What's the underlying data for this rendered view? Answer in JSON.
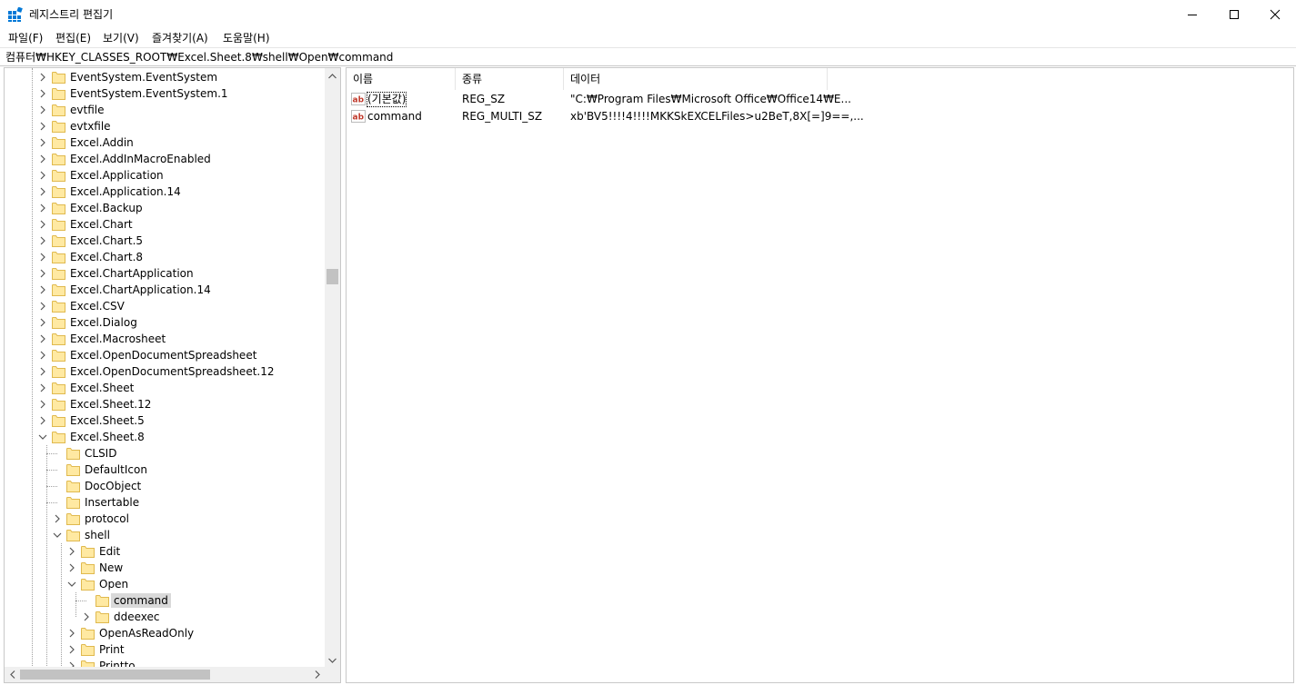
{
  "window": {
    "title": "레지스트리 편집기",
    "accent_color": "#0078d7"
  },
  "menu": [
    "파일(F)",
    "편집(E)",
    "보기(V)",
    "즐겨찾기(A)",
    "도움말(H)"
  ],
  "address": "컴퓨터₩HKEY_CLASSES_ROOT₩Excel.Sheet.8₩shell₩Open₩command",
  "tree": [
    {
      "label": "EventSystem.EventSystem",
      "level": 0,
      "state": "collapsed"
    },
    {
      "label": "EventSystem.EventSystem.1",
      "level": 0,
      "state": "collapsed"
    },
    {
      "label": "evtfile",
      "level": 0,
      "state": "collapsed"
    },
    {
      "label": "evtxfile",
      "level": 0,
      "state": "collapsed"
    },
    {
      "label": "Excel.Addin",
      "level": 0,
      "state": "collapsed"
    },
    {
      "label": "Excel.AddInMacroEnabled",
      "level": 0,
      "state": "collapsed"
    },
    {
      "label": "Excel.Application",
      "level": 0,
      "state": "collapsed"
    },
    {
      "label": "Excel.Application.14",
      "level": 0,
      "state": "collapsed"
    },
    {
      "label": "Excel.Backup",
      "level": 0,
      "state": "collapsed"
    },
    {
      "label": "Excel.Chart",
      "level": 0,
      "state": "collapsed"
    },
    {
      "label": "Excel.Chart.5",
      "level": 0,
      "state": "collapsed"
    },
    {
      "label": "Excel.Chart.8",
      "level": 0,
      "state": "collapsed"
    },
    {
      "label": "Excel.ChartApplication",
      "level": 0,
      "state": "collapsed"
    },
    {
      "label": "Excel.ChartApplication.14",
      "level": 0,
      "state": "collapsed"
    },
    {
      "label": "Excel.CSV",
      "level": 0,
      "state": "collapsed"
    },
    {
      "label": "Excel.Dialog",
      "level": 0,
      "state": "collapsed"
    },
    {
      "label": "Excel.Macrosheet",
      "level": 0,
      "state": "collapsed"
    },
    {
      "label": "Excel.OpenDocumentSpreadsheet",
      "level": 0,
      "state": "collapsed"
    },
    {
      "label": "Excel.OpenDocumentSpreadsheet.12",
      "level": 0,
      "state": "collapsed"
    },
    {
      "label": "Excel.Sheet",
      "level": 0,
      "state": "collapsed"
    },
    {
      "label": "Excel.Sheet.12",
      "level": 0,
      "state": "collapsed"
    },
    {
      "label": "Excel.Sheet.5",
      "level": 0,
      "state": "collapsed"
    },
    {
      "label": "Excel.Sheet.8",
      "level": 0,
      "state": "expanded"
    },
    {
      "label": "CLSID",
      "level": 1,
      "state": "leaf"
    },
    {
      "label": "DefaultIcon",
      "level": 1,
      "state": "leaf"
    },
    {
      "label": "DocObject",
      "level": 1,
      "state": "leaf"
    },
    {
      "label": "Insertable",
      "level": 1,
      "state": "leaf"
    },
    {
      "label": "protocol",
      "level": 1,
      "state": "collapsed"
    },
    {
      "label": "shell",
      "level": 1,
      "state": "expanded"
    },
    {
      "label": "Edit",
      "level": 2,
      "state": "collapsed"
    },
    {
      "label": "New",
      "level": 2,
      "state": "collapsed"
    },
    {
      "label": "Open",
      "level": 2,
      "state": "expanded"
    },
    {
      "label": "command",
      "level": 3,
      "state": "leaf",
      "selected": true
    },
    {
      "label": "ddeexec",
      "level": 3,
      "state": "collapsed"
    },
    {
      "label": "OpenAsReadOnly",
      "level": 2,
      "state": "collapsed"
    },
    {
      "label": "Print",
      "level": 2,
      "state": "collapsed"
    },
    {
      "label": "Printto",
      "level": 2,
      "state": "collapsed"
    }
  ],
  "columns": [
    "이름",
    "종류",
    "데이터"
  ],
  "values": [
    {
      "name": "(기본값)",
      "type": "REG_SZ",
      "data": "\"C:₩Program Files₩Microsoft Office₩Office14₩E..."
    },
    {
      "name": "command",
      "type": "REG_MULTI_SZ",
      "data": "xb'BV5!!!!4!!!!MKKSkEXCELFiles>u2BeT,8X[=]9==,..."
    }
  ]
}
